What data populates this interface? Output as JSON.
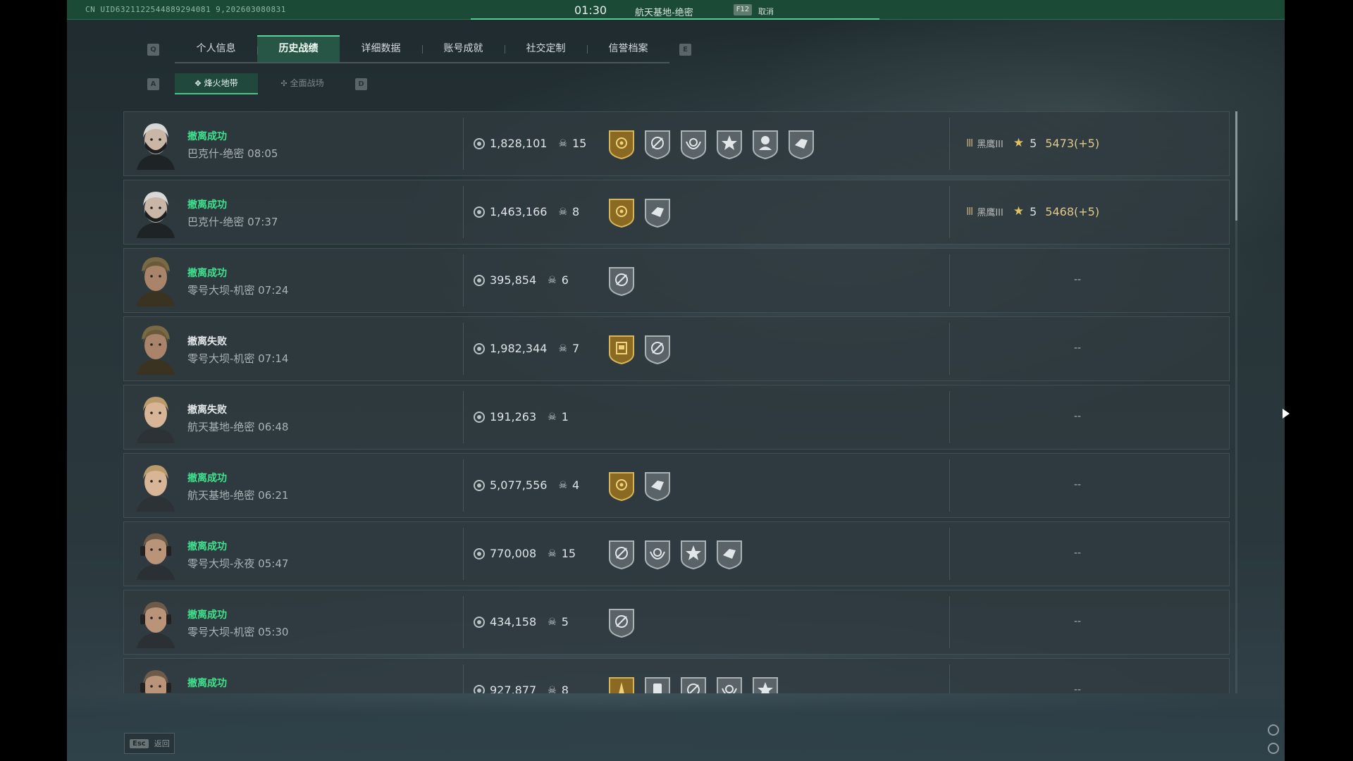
{
  "topbar": {
    "uid": "CN UID6321122544889294081 9,202603080831",
    "timer": "01:30",
    "map": "航天基地-绝密",
    "key": "F12",
    "cancel": "取消"
  },
  "nav": {
    "left_key": "Q",
    "right_key": "E",
    "tabs": [
      "个人信息",
      "历史战绩",
      "详细数据",
      "账号成就",
      "社交定制",
      "信誉档案"
    ],
    "active_tab": 1
  },
  "subnav": {
    "left_key": "A",
    "right_key": "D",
    "tabs": [
      "烽火地带",
      "全面战场"
    ],
    "active": 0
  },
  "records": [
    {
      "status": "撤离成功",
      "ok": true,
      "map": "巴克什-绝密 08:05",
      "money": "1,828,101",
      "kills": "15",
      "avatar": "masked",
      "badges": [
        "gold-shield",
        "escape",
        "wing",
        "star",
        "operator",
        "combo"
      ],
      "rank": "黑鹰III",
      "level": "5",
      "score": "5473(+5)"
    },
    {
      "status": "撤离成功",
      "ok": true,
      "map": "巴克什-绝密 07:37",
      "money": "1,463,166",
      "kills": "8",
      "avatar": "masked",
      "badges": [
        "gold-shield",
        "combo"
      ],
      "rank": "黑鹰III",
      "level": "5",
      "score": "5468(+5)"
    },
    {
      "status": "撤离成功",
      "ok": true,
      "map": "零号大坝-机密 07:24",
      "money": "395,854",
      "kills": "6",
      "avatar": "helmet",
      "badges": [
        "escape"
      ],
      "rank": "",
      "level": "",
      "score": "",
      "dash": "--"
    },
    {
      "status": "撤离失败",
      "ok": false,
      "map": "零号大坝-机密 07:14",
      "money": "1,982,344",
      "kills": "7",
      "avatar": "helmet",
      "badges": [
        "gold-box",
        "escape"
      ],
      "rank": "",
      "level": "",
      "score": "",
      "dash": "--"
    },
    {
      "status": "撤离失败",
      "ok": false,
      "map": "航天基地-绝密 06:48",
      "money": "191,263",
      "kills": "1",
      "avatar": "blonde",
      "badges": [],
      "rank": "",
      "level": "",
      "score": "",
      "dash": "--"
    },
    {
      "status": "撤离成功",
      "ok": true,
      "map": "航天基地-绝密 06:21",
      "money": "5,077,556",
      "kills": "4",
      "avatar": "blonde",
      "badges": [
        "gold-shield",
        "combo"
      ],
      "rank": "",
      "level": "",
      "score": "",
      "dash": "--"
    },
    {
      "status": "撤离成功",
      "ok": true,
      "map": "零号大坝-永夜 05:47",
      "money": "770,008",
      "kills": "15",
      "avatar": "headset",
      "badges": [
        "escape",
        "wing",
        "star",
        "combo"
      ],
      "rank": "",
      "level": "",
      "score": "",
      "dash": "--"
    },
    {
      "status": "撤离成功",
      "ok": true,
      "map": "零号大坝-机密 05:30",
      "money": "434,158",
      "kills": "5",
      "avatar": "headset",
      "badges": [
        "escape"
      ],
      "rank": "",
      "level": "",
      "score": "",
      "dash": "--"
    },
    {
      "status": "撤离成功",
      "ok": true,
      "map": "",
      "money": "927,877",
      "kills": "8",
      "avatar": "headset",
      "badges": [
        "gold-tower",
        "clip",
        "escape",
        "wing",
        "star"
      ],
      "rank": "",
      "level": "",
      "score": "",
      "dash": "--"
    }
  ],
  "footer": {
    "esc_key": "Esc",
    "esc_label": "返回"
  },
  "colors": {
    "success": "#3fe38d",
    "accent": "#58d69a",
    "topbar": "#1b4a37",
    "gold": "#c9a448"
  }
}
